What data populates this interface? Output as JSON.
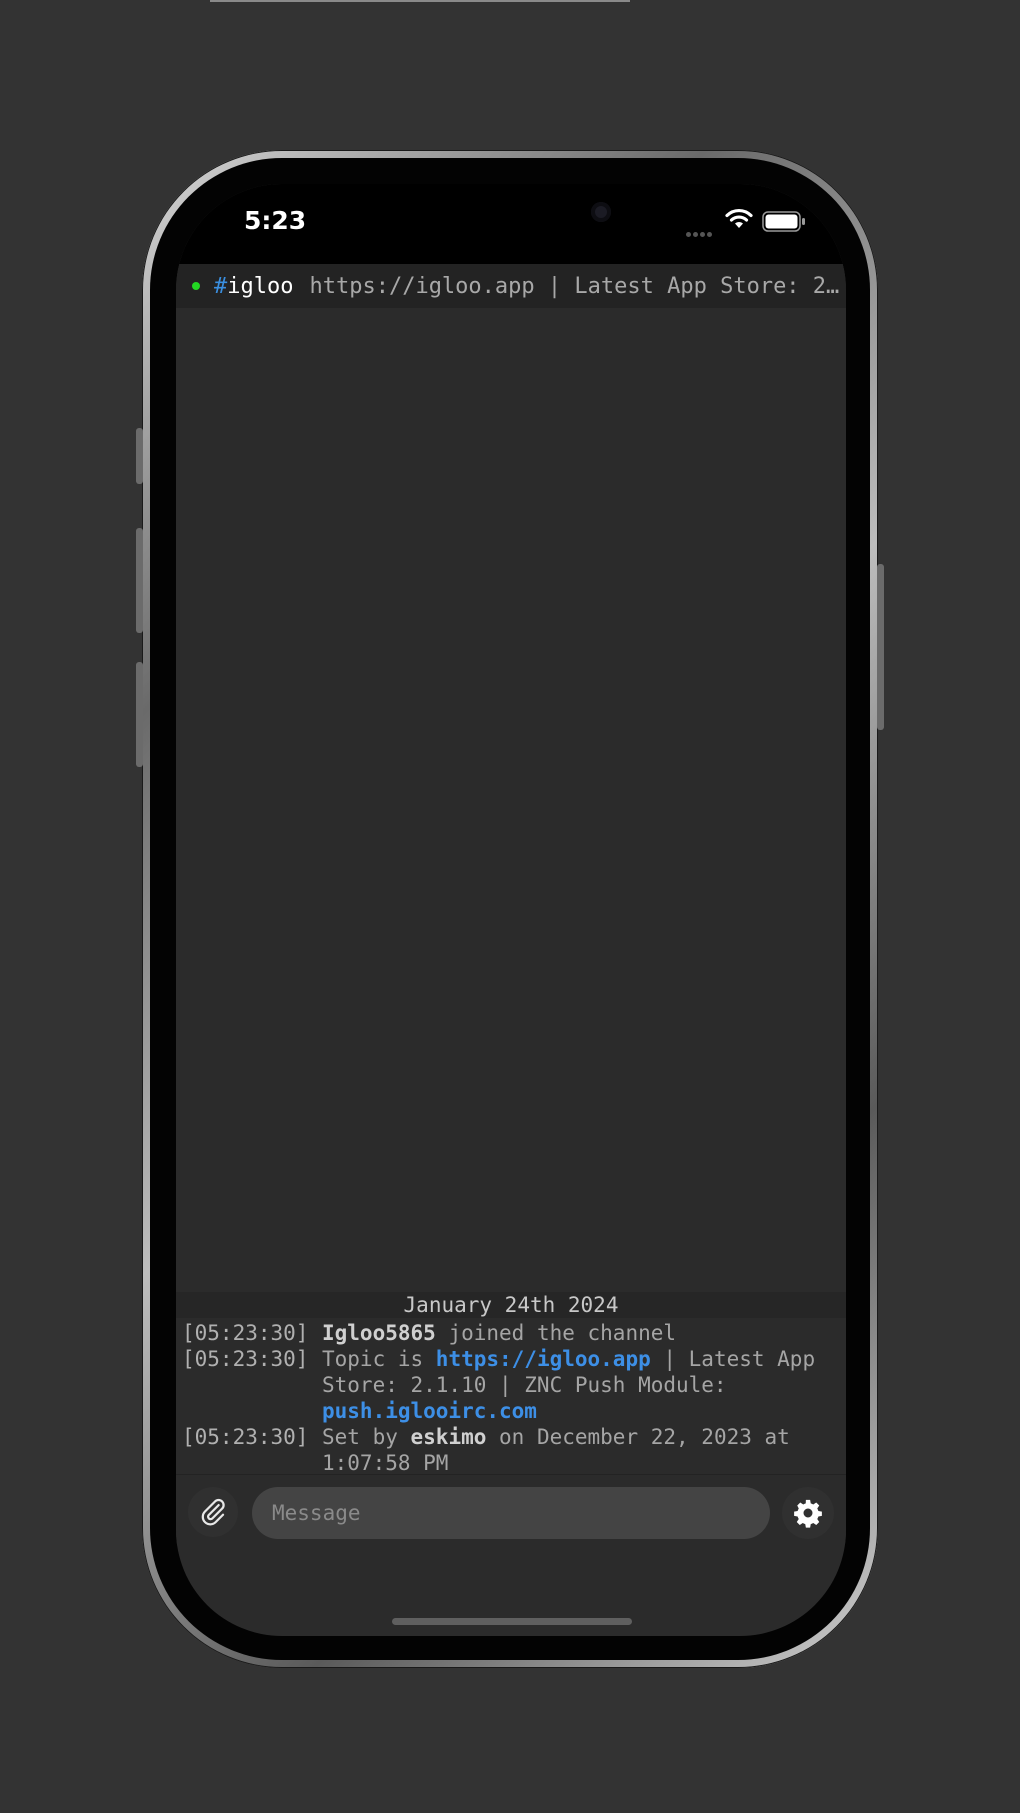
{
  "status_bar": {
    "time": "5:23"
  },
  "channel": {
    "hash": "#",
    "name": "igloo",
    "topic_preview": "https://igloo.app | Latest App Store: 2.1.10 | ZNC Push Module: push.iglooirc.com",
    "status_color": "#22d622"
  },
  "date_header": "January 24th 2024",
  "messages": [
    {
      "timestamp": "[05:23:30]",
      "nick": "Igloo5865",
      "text": " joined the channel"
    },
    {
      "timestamp": "[05:23:30]",
      "prefix": "Topic is ",
      "link1": "https://igloo.app",
      "middle": " | Latest App Store: 2.1.10 | ZNC Push Module: ",
      "link2": "push.iglooirc.com"
    },
    {
      "timestamp": "[05:23:30]",
      "prefix": "Set by ",
      "nick": "eskimo",
      "suffix": " on December 22, 2023 at 1:07:58 PM"
    }
  ],
  "composer": {
    "placeholder": "Message",
    "attach_icon": "paperclip-icon",
    "settings_icon": "gear-icon"
  },
  "colors": {
    "link": "#3d8fe6",
    "background": "#2b2b2b"
  }
}
